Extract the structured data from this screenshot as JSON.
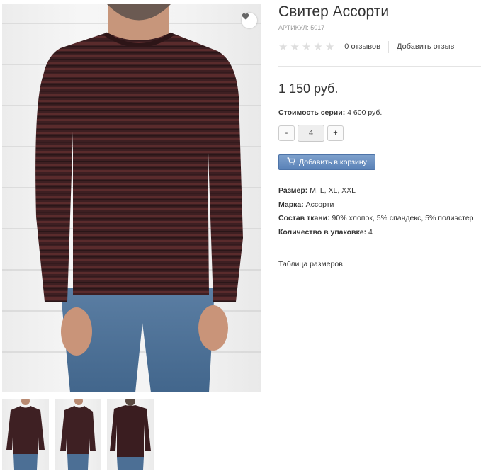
{
  "product": {
    "title": "Свитер Ассорти",
    "sku": "АРТИКУЛ: 5017",
    "rating": {
      "stars": 0,
      "max": 5,
      "reviews_label": "0 отзывов",
      "add_review_label": "Добавить отзыв"
    },
    "price": "1 150 руб.",
    "series_cost": {
      "label": "Стоимость серии:",
      "value": "4 600 руб."
    },
    "quantity": {
      "minus": "-",
      "value": "4",
      "plus": "+"
    },
    "add_to_cart_label": "Добавить в корзину",
    "specs": [
      {
        "label": "Размер:",
        "value": "M, L, XL, XXL"
      },
      {
        "label": "Марка:",
        "value": "Ассорти"
      },
      {
        "label": "Состав ткани:",
        "value": "90% хлопок, 5% спандекс, 5% полиэстер"
      },
      {
        "label": "Количество в упаковке:",
        "value": "4"
      }
    ],
    "size_table_link": "Таблица размеров"
  },
  "gallery": {
    "main_image": "sweater-front-photo",
    "thumbnails": [
      "sweater-front-photo",
      "sweater-side-photo",
      "sweater-back-photo"
    ],
    "wishlist_icon": "heart-icon"
  },
  "colors": {
    "accent": "#5a82b8",
    "sweater": "#3e2023",
    "jeans": "#4c6f95",
    "muted_text": "#999999"
  }
}
